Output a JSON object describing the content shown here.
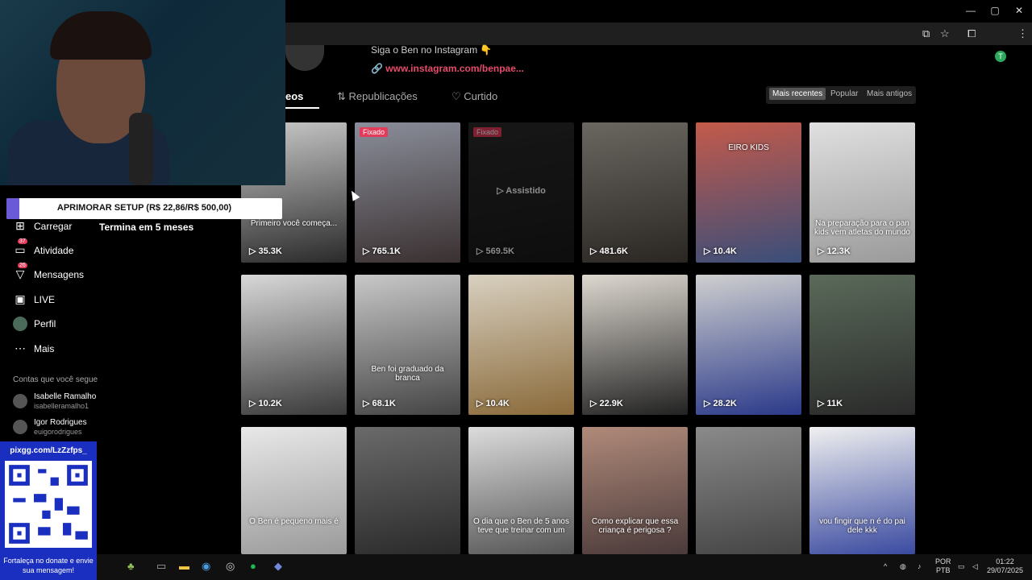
{
  "window": {
    "minimize": "—",
    "restore": "▢",
    "close": "✕"
  },
  "toolbar": {
    "profile_initial": "T",
    "menu": "⋮"
  },
  "profile": {
    "bio_line": "Siga o Ben no Instagram 👇",
    "link_icon": "link-icon",
    "link": "www.instagram.com/benpae..."
  },
  "tabs": [
    {
      "label": "Vídeos",
      "visible_label": "eos"
    },
    {
      "label": "Republicações",
      "icon": "repost-icon"
    },
    {
      "label": "Curtido",
      "icon": "heart-icon"
    }
  ],
  "sort": {
    "recent": "Mais recentes",
    "popular": "Popular",
    "oldest": "Mais antigos"
  },
  "videos": [
    {
      "views": "35.3K",
      "caption": "Primeiro você começa...",
      "pinned": "",
      "watched": "",
      "colors": [
        "#c9c9c9",
        "#2a2a2a"
      ]
    },
    {
      "views": "765.1K",
      "pinned": "Fixado",
      "watched": "",
      "caption": "",
      "colors": [
        "#8a8e9a",
        "#3a3030"
      ]
    },
    {
      "views": "569.5K",
      "pinned": "Fixado",
      "watched": "Assistido",
      "caption": "",
      "colors": [
        "#2a2a2a",
        "#1a1a1a"
      ]
    },
    {
      "views": "481.6K",
      "pinned": "",
      "watched": "",
      "caption": "",
      "colors": [
        "#6a6660",
        "#2a2622"
      ]
    },
    {
      "views": "10.4K",
      "pinned": "",
      "watched": "",
      "caption": "EIRO KIDS",
      "colors": [
        "#c45a4a",
        "#3a4e7a"
      ]
    },
    {
      "views": "12.3K",
      "pinned": "",
      "watched": "",
      "caption": "Na preparação para o pan kids vem atletas do mundo",
      "colors": [
        "#e0e0e0",
        "#9a9a9a"
      ]
    },
    {
      "views": "10.2K",
      "pinned": "",
      "watched": "",
      "caption": "",
      "colors": [
        "#d8d8d8",
        "#3a3a3a"
      ]
    },
    {
      "views": "68.1K",
      "pinned": "",
      "watched": "",
      "caption": "Ben foi graduado da branca",
      "colors": [
        "#c8c8c8",
        "#444"
      ]
    },
    {
      "views": "10.4K",
      "pinned": "",
      "watched": "",
      "caption": "",
      "colors": [
        "#d8d0c0",
        "#8a6a3a"
      ]
    },
    {
      "views": "22.9K",
      "pinned": "",
      "watched": "",
      "caption": "",
      "colors": [
        "#ddd8d0",
        "#222"
      ]
    },
    {
      "views": "28.2K",
      "pinned": "",
      "watched": "",
      "caption": "",
      "colors": [
        "#cfcfcf",
        "#2b3a8a"
      ]
    },
    {
      "views": "11K",
      "pinned": "",
      "watched": "",
      "caption": "",
      "colors": [
        "#5a6a5a",
        "#2a2a2a"
      ]
    },
    {
      "views": "",
      "pinned": "",
      "watched": "",
      "caption": "O Ben é pequeno mais é",
      "colors": [
        "#e8e8e8",
        "#9a9a9a"
      ]
    },
    {
      "views": "",
      "pinned": "",
      "watched": "",
      "caption": "",
      "colors": [
        "#6a6a6a",
        "#2a2a2a"
      ]
    },
    {
      "views": "",
      "pinned": "",
      "watched": "",
      "caption": "O dia que o Ben de 5 anos teve que treinar com um",
      "colors": [
        "#dcdcdc",
        "#555"
      ]
    },
    {
      "views": "",
      "pinned": "",
      "watched": "",
      "caption": "Como explicar que essa criança é perigosa ?",
      "colors": [
        "#b08a7a",
        "#4a3a3a"
      ]
    },
    {
      "views": "",
      "pinned": "",
      "watched": "",
      "caption": "",
      "colors": [
        "#8a8a8a",
        "#444"
      ]
    },
    {
      "views": "",
      "pinned": "",
      "watched": "",
      "caption": "vou fingir que n é do pai dele kkk",
      "colors": [
        "#f0f0f0",
        "#3a4aa0"
      ]
    }
  ],
  "donation": {
    "goal": "APRIMORAR SETUP (R$ 22,86/R$ 500,00)",
    "progress_pct": 4.6,
    "ends": "Termina em 5 meses"
  },
  "nav": [
    {
      "label": "Carregar",
      "icon": "upload-icon",
      "badge": ""
    },
    {
      "label": "Atividade",
      "icon": "inbox-icon",
      "badge": "37"
    },
    {
      "label": "Mensagens",
      "icon": "message-icon",
      "badge": "26"
    },
    {
      "label": "LIVE",
      "icon": "live-icon",
      "badge": ""
    },
    {
      "label": "Perfil",
      "icon": "profile-icon",
      "badge": ""
    },
    {
      "label": "Mais",
      "icon": "more-icon",
      "badge": ""
    }
  ],
  "following": {
    "heading": "Contas que você segue",
    "accounts": [
      {
        "name": "Isabelle Ramalho",
        "user": "isabelleramalho1"
      },
      {
        "name": "Igor Rodrigues",
        "user": "euigorodrigues"
      }
    ]
  },
  "qr": {
    "url": "pixgg.com/LzZzfps_",
    "message": "Fortaleça no donate e envie sua mensagem!"
  },
  "tray": {
    "lang1": "POR",
    "lang2": "PTB",
    "time": "01:22",
    "date": "29/07/2025"
  }
}
